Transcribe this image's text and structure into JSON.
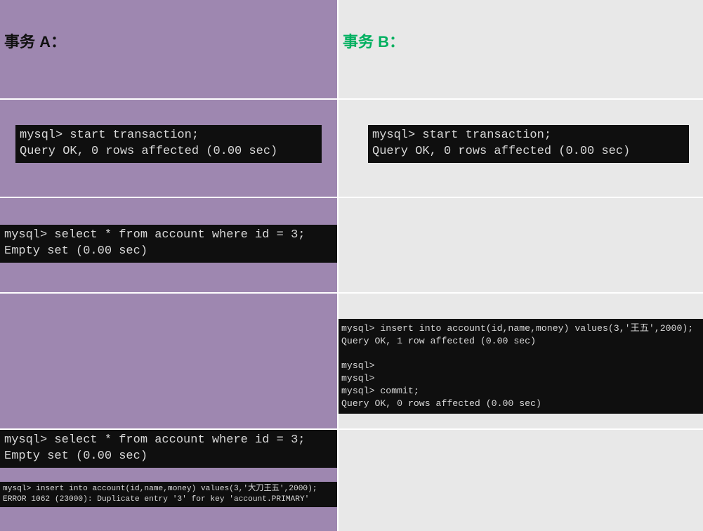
{
  "headers": {
    "a": "事务 A：",
    "b": "事务 B："
  },
  "terminals": {
    "a_start": "mysql> start transaction;\nQuery OK, 0 rows affected (0.00 sec)",
    "b_start": "mysql> start transaction;\nQuery OK, 0 rows affected (0.00 sec)",
    "a_select1": "mysql> select * from account where id = 3;\nEmpty set (0.00 sec)",
    "b_insert": "mysql> insert into account(id,name,money) values(3,'王五',2000);\nQuery OK, 1 row affected (0.00 sec)\n\nmysql>\nmysql>\nmysql> commit;\nQuery OK, 0 rows affected (0.00 sec)",
    "a_select2": "mysql> select * from account where id = 3;\nEmpty set (0.00 sec)",
    "a_insert_err": "mysql> insert into account(id,name,money) values(3,'大刀王五',2000);\nERROR 1062 (23000): Duplicate entry '3' for key 'account.PRIMARY'"
  }
}
